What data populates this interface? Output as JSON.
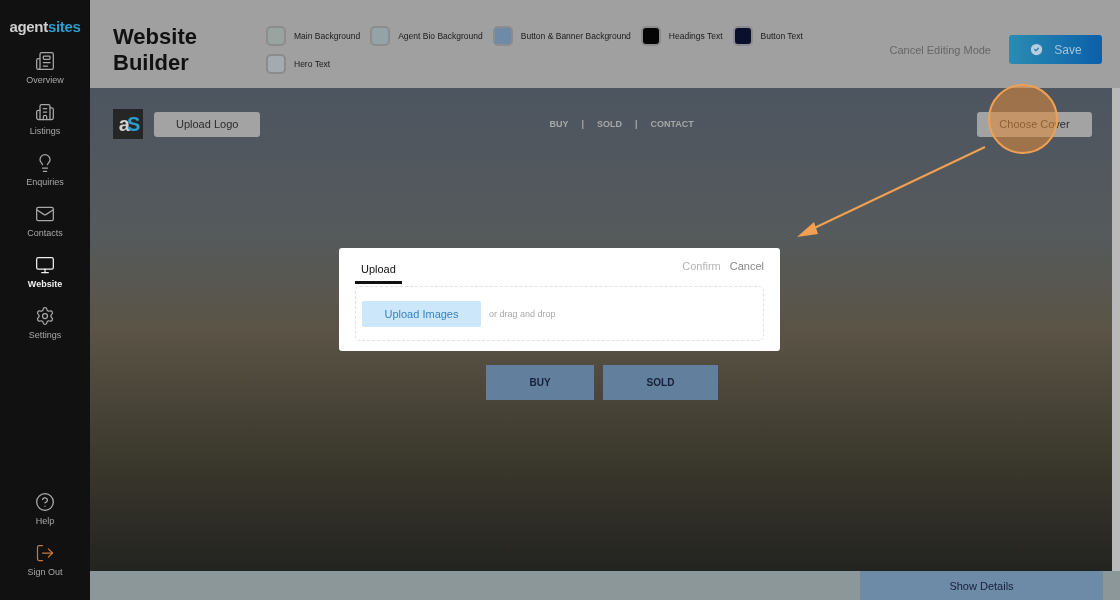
{
  "sidebar": {
    "brand": {
      "part_1": "agent",
      "part_2": "sites"
    },
    "items": [
      {
        "label": "Overview",
        "selected": false
      },
      {
        "label": "Listings",
        "selected": false
      },
      {
        "label": "Enquiries",
        "selected": false
      },
      {
        "label": "Contacts",
        "selected": false
      },
      {
        "label": "Website",
        "selected": true
      },
      {
        "label": "Settings",
        "selected": false
      }
    ],
    "bottom_items": [
      {
        "label": "Help"
      },
      {
        "label": "Sign Out"
      }
    ]
  },
  "header": {
    "title": "Website Builder",
    "swatches": [
      {
        "label": "Main Background",
        "color": "#9aa3a0"
      },
      {
        "label": "Agent Bio Background",
        "color": "#95a2a6"
      },
      {
        "label": "Button & Banner Background",
        "color": "#6d8aa6"
      },
      {
        "label": "Headings Text",
        "color": "#050505"
      },
      {
        "label": "Button Text",
        "color": "#0a0f2e"
      },
      {
        "label": "Hero Text",
        "color": "#a3aab0"
      }
    ],
    "cancel": "Cancel Editing Mode",
    "save": "Save"
  },
  "hero": {
    "logo_mark": {
      "part_1": "a",
      "part_2": "S"
    },
    "upload_logo": "Upload Logo",
    "nav": [
      "BUY",
      "SOLD",
      "CONTACT"
    ],
    "nav_separators": [
      "|",
      "|"
    ],
    "choose_cover": "Choose Cover",
    "buttons": [
      "BUY",
      "SOLD"
    ]
  },
  "dialog": {
    "tabs": [
      {
        "label": "Upload",
        "selected": true
      }
    ],
    "confirm": {
      "label": "Confirm",
      "disabled": true
    },
    "cancel": "Cancel",
    "upload_button": "Upload Images",
    "drop_hint": "or drag and drop"
  },
  "footer": {
    "show_details": "Show Details"
  }
}
